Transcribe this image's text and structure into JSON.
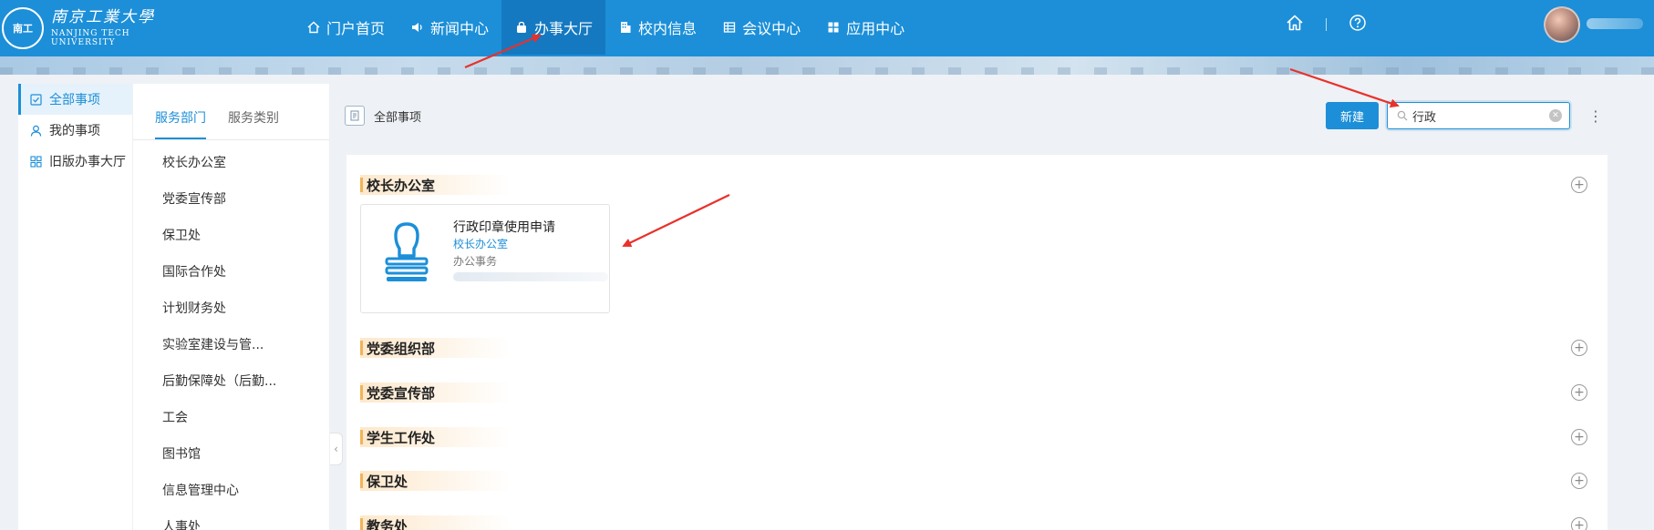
{
  "brand": {
    "seal_text": "南工",
    "name_cn": "南京工業大學",
    "name_en_1": "NANJING TECH",
    "name_en_2": "UNIVERSITY"
  },
  "nav": [
    {
      "label": "门户首页",
      "icon": "home-icon"
    },
    {
      "label": "新闻中心",
      "icon": "speaker-icon"
    },
    {
      "label": "办事大厅",
      "icon": "bag-icon",
      "active": true
    },
    {
      "label": "校内信息",
      "icon": "building-icon"
    },
    {
      "label": "会议中心",
      "icon": "table-icon"
    },
    {
      "label": "应用中心",
      "icon": "grid-icon"
    }
  ],
  "sidebar": {
    "items": [
      {
        "label": "全部事项",
        "icon": "checkbox-icon",
        "active": true
      },
      {
        "label": "我的事项",
        "icon": "user-icon"
      },
      {
        "label": "旧版办事大厅",
        "icon": "grid-icon"
      }
    ]
  },
  "dept_panel": {
    "tabs": [
      {
        "label": "服务部门",
        "active": true
      },
      {
        "label": "服务类别"
      }
    ],
    "items": [
      "校长办公室",
      "党委宣传部",
      "保卫处",
      "国际合作处",
      "计划财务处",
      "实验室建设与管...",
      "后勤保障处（后勤...",
      "工会",
      "图书馆",
      "信息管理中心",
      "人事处"
    ]
  },
  "main": {
    "breadcrumb": "全部事项",
    "new_button": "新建",
    "search": {
      "value": "行政",
      "placeholder": ""
    },
    "sections": [
      {
        "title": "校长办公室"
      },
      {
        "title": "党委组织部"
      },
      {
        "title": "党委宣传部"
      },
      {
        "title": "学生工作处"
      },
      {
        "title": "保卫处"
      },
      {
        "title": "教务处"
      }
    ],
    "card": {
      "title": "行政印章使用申请",
      "department": "校长办公室",
      "category": "办公事务"
    }
  },
  "colors": {
    "primary": "#1c8fd8",
    "nav_active": "#1479c0",
    "section_accent": "#f0b45a",
    "annotation": "#e8312a"
  }
}
